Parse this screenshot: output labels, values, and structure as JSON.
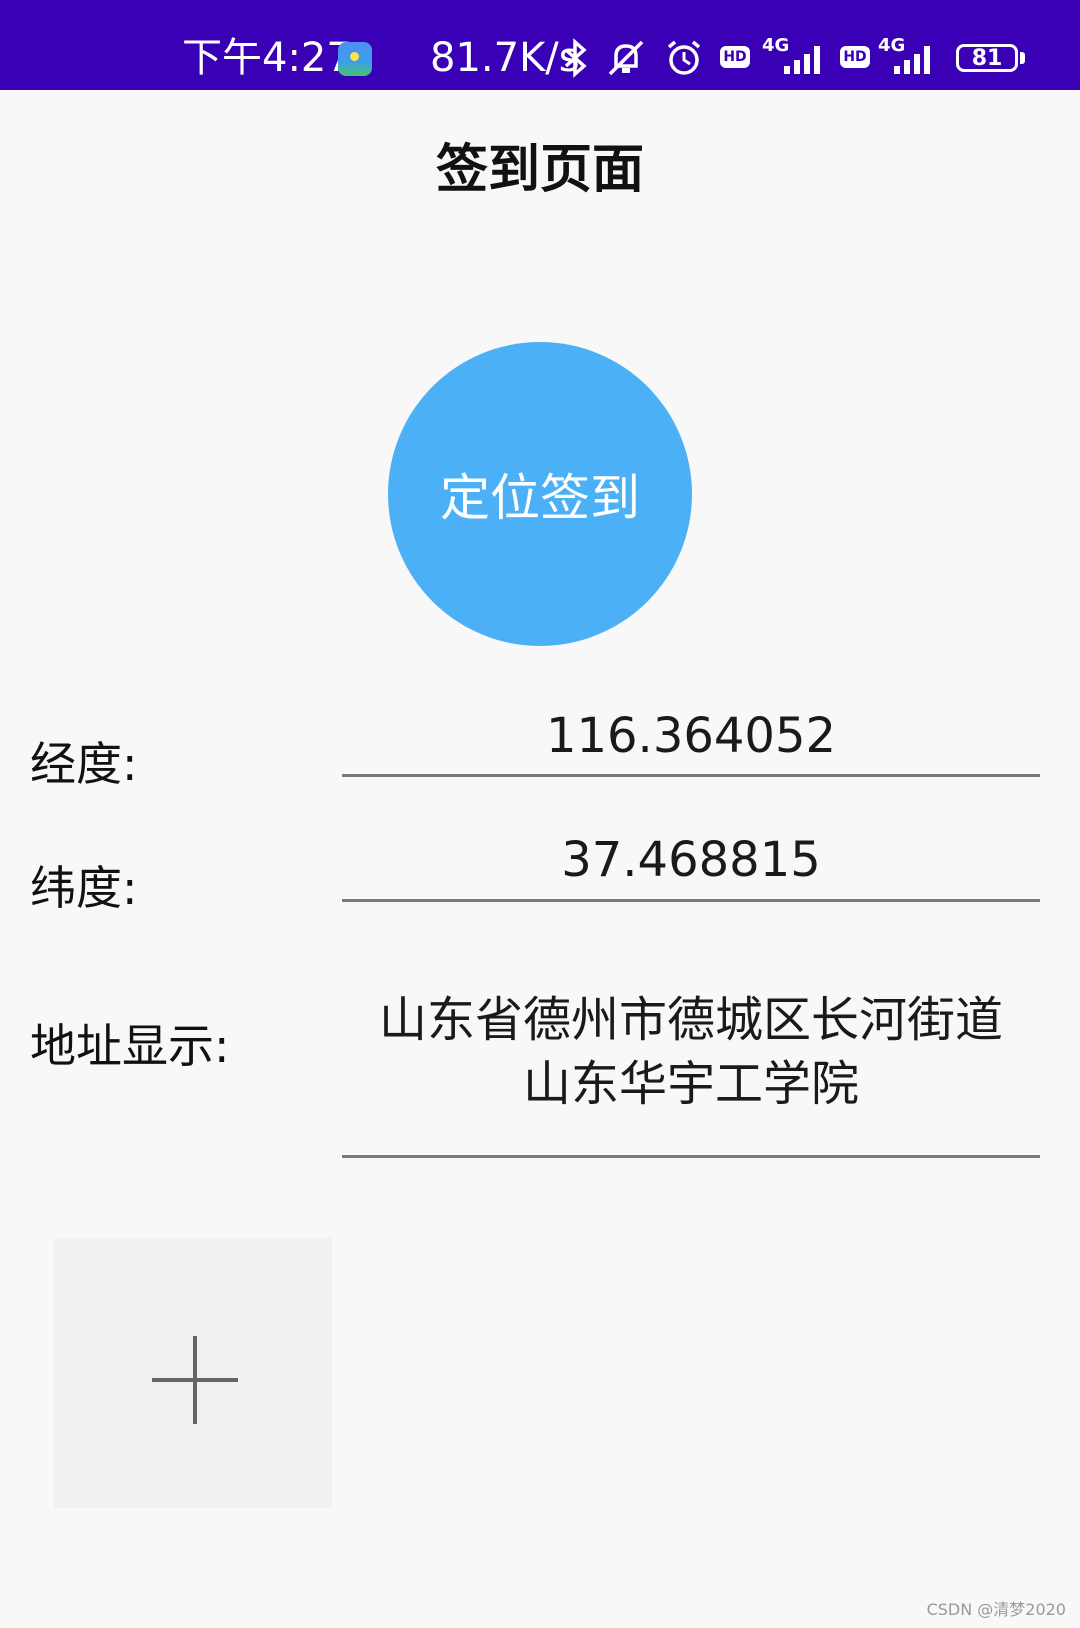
{
  "status_bar": {
    "time": "下午4:27",
    "net_speed": "81.7K/s",
    "hd_badge": "HD",
    "network_type": "4G",
    "battery": "81"
  },
  "header": {
    "title": "签到页面"
  },
  "checkin": {
    "button_label": "定位签到"
  },
  "fields": {
    "longitude": {
      "label": "经度:",
      "value": "116.364052"
    },
    "latitude": {
      "label": "纬度:",
      "value": "37.468815"
    },
    "address": {
      "label": "地址显示:",
      "line1": "山东省德州市德城区长河街道",
      "line2": "山东华宇工学院"
    }
  },
  "watermark": "CSDN @清梦2020",
  "colors": {
    "status_bar": "#3a00b5",
    "button": "#4bb0f5",
    "background": "#f8f8f8",
    "underline": "#7a7a7a"
  }
}
